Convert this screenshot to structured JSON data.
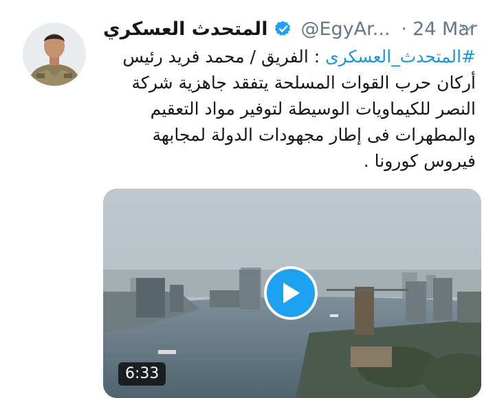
{
  "tweet": {
    "display_name": "المتحدث العسكري",
    "verified": true,
    "handle": "@EgyAr...",
    "separator": "·",
    "date": "24 Mar",
    "hashtag": "#المتحدث_العسكرى",
    "text": " : الفريق / محمد فريد رئيس أركان حرب القوات المسلحة يتفقد جاهزية شركة النصر للكيماويات الوسيطة لتوفير مواد التعقيم والمطهرات فى إطار مجهودات الدولة لمجابهة فيروس كورونا ."
  },
  "media": {
    "type": "video",
    "duration": "6:33"
  },
  "icons": {
    "verified": "verified-badge-icon",
    "more": "chevron-down-icon",
    "play": "play-icon"
  },
  "colors": {
    "accent": "#1da1f2",
    "hashtag": "#1b95e0",
    "secondary_text": "#657786",
    "primary_text": "#14171a"
  }
}
